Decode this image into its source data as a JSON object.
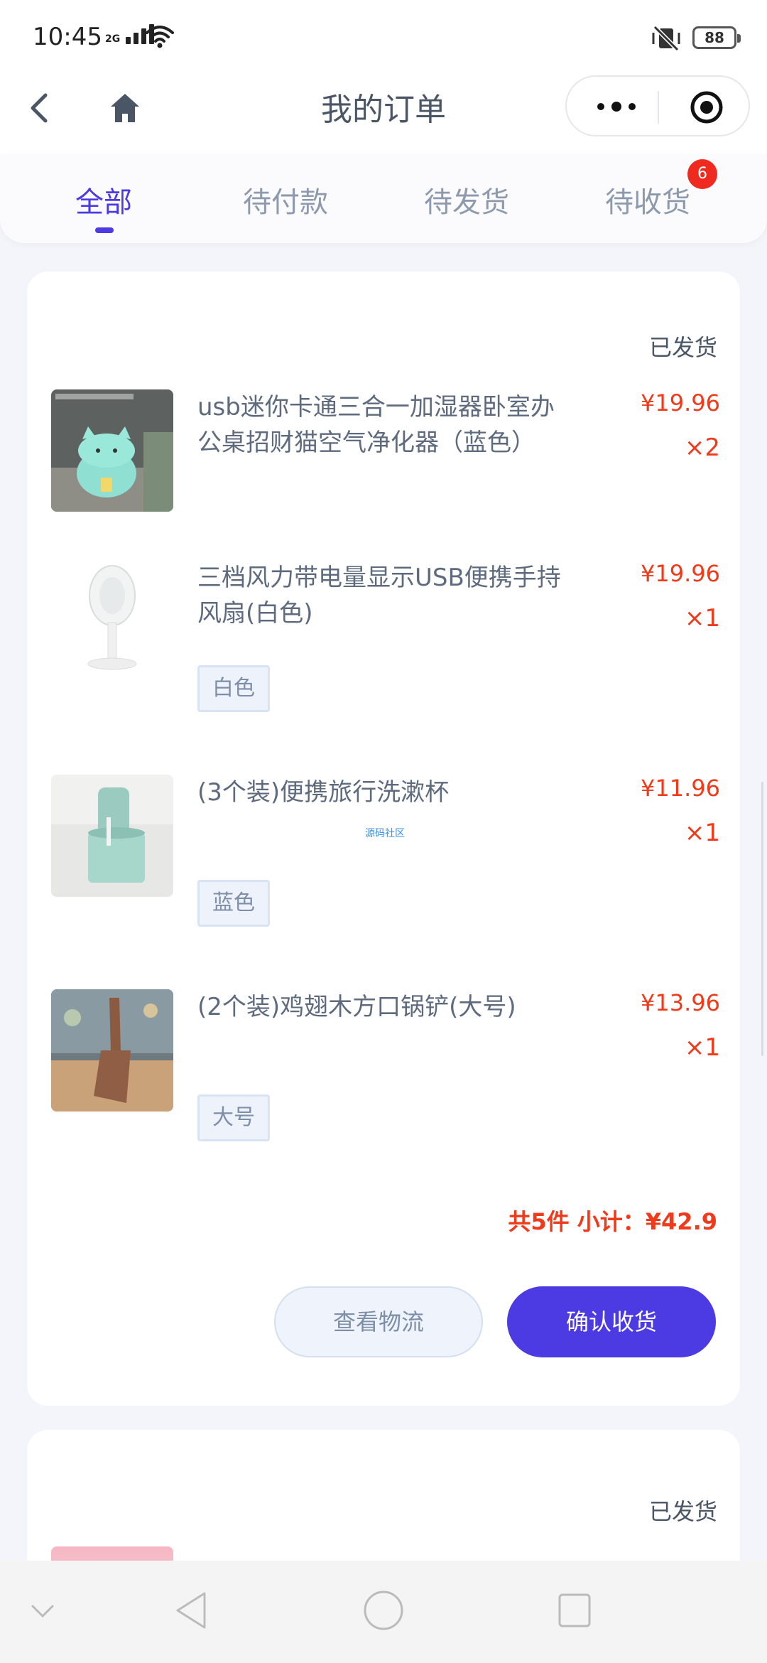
{
  "status_bar": {
    "time": "10:45",
    "network": "2G",
    "battery": "88"
  },
  "nav": {
    "title": "我的订单",
    "back_icon": "chevron-left-icon",
    "home_icon": "home-icon",
    "capsule_more_icon": "more-dots-icon",
    "capsule_close_icon": "target-circle-icon"
  },
  "tabs": [
    {
      "label": "全部",
      "active": true
    },
    {
      "label": "待付款",
      "active": false
    },
    {
      "label": "待发货",
      "active": false
    },
    {
      "label": "待收货",
      "active": false,
      "badge": "6"
    }
  ],
  "order": {
    "status": "已发货",
    "items": [
      {
        "name": "usb迷你卡通三合一加湿器卧室办公桌招财猫空气净化器（蓝色）",
        "price": "¥19.96",
        "qty": "×2",
        "spec": ""
      },
      {
        "name": "三档风力带电量显示USB便携手持风扇(白色)",
        "price": "¥19.96",
        "qty": "×1",
        "spec": "白色"
      },
      {
        "name": "(3个装)便携旅行洗漱杯",
        "price": "¥11.96",
        "qty": "×1",
        "spec": "蓝色"
      },
      {
        "name": "(2个装)鸡翅木方口锅铲(大号)",
        "price": "¥13.96",
        "qty": "×1",
        "spec": "大号"
      }
    ],
    "watermark": "源码社区",
    "subtotal": "共5件 小计：¥42.9",
    "btn_logistics": "查看物流",
    "btn_confirm": "确认收货"
  },
  "order2": {
    "status": "已发货"
  },
  "colors": {
    "accent": "#4c3ae3",
    "price": "#f03a1a",
    "badge": "#f02a1e"
  }
}
